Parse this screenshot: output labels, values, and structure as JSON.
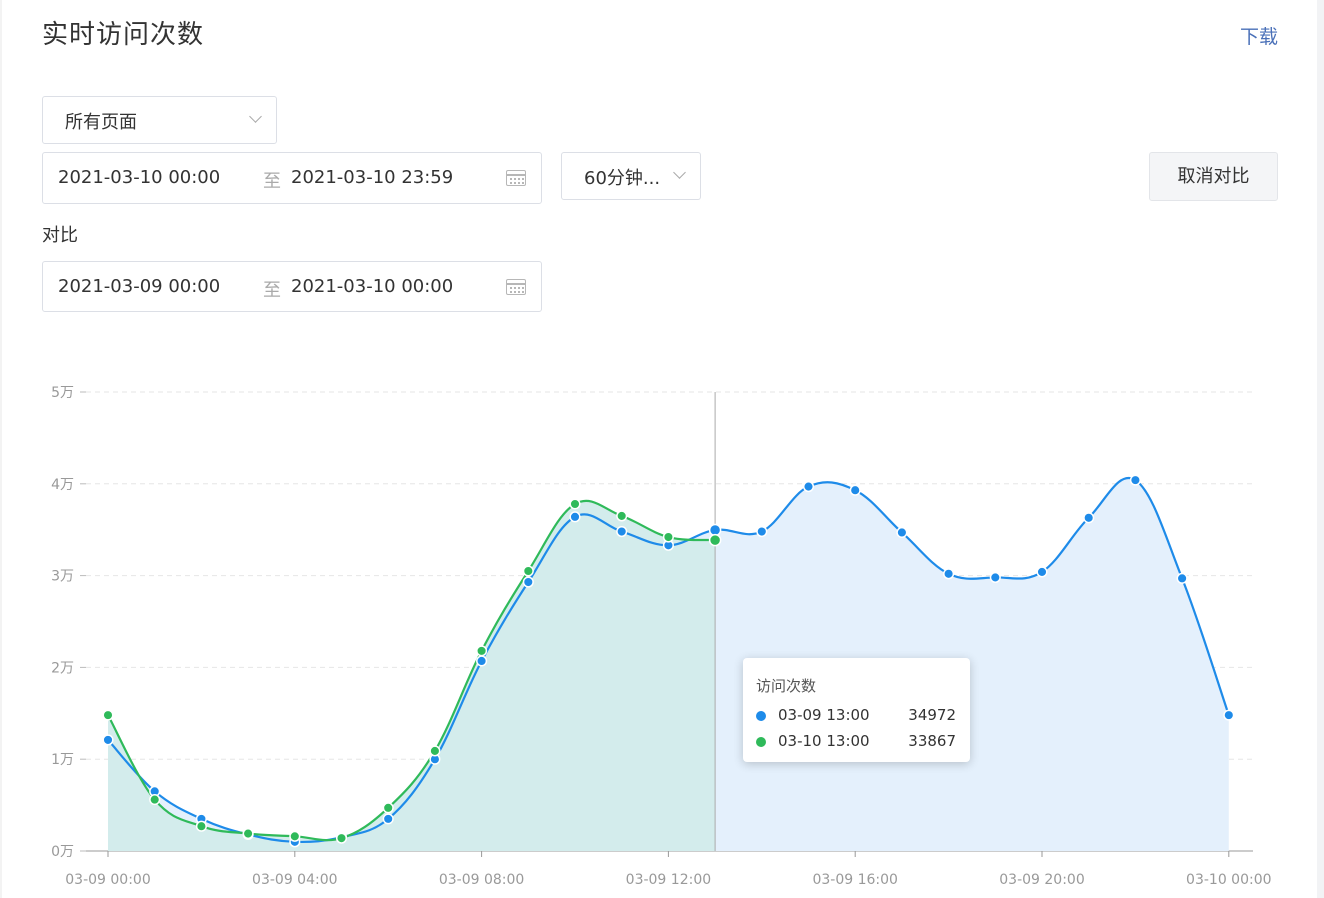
{
  "header": {
    "title": "实时访问次数",
    "download_label": "下载"
  },
  "filters": {
    "page_select": "所有页面",
    "date_range": {
      "start": "2021-03-10 00:00",
      "separator": "至",
      "end": "2021-03-10 23:59"
    },
    "interval_select": "60分钟...",
    "cancel_compare_label": "取消对比",
    "compare_label": "对比",
    "compare_range": {
      "start": "2021-03-09 00:00",
      "separator": "至",
      "end": "2021-03-10 00:00"
    }
  },
  "colors": {
    "series_current": "#1e8be9",
    "series_compare": "#2fba5a",
    "fill_current": "#e4f0fc",
    "fill_compare": "#d3ecec"
  },
  "chart_data": {
    "type": "area",
    "title": "",
    "xlabel": "",
    "ylabel": "",
    "ylim": [
      0,
      50000
    ],
    "y_ticks": [
      "0万",
      "1万",
      "2万",
      "3万",
      "4万",
      "5万"
    ],
    "x_ticks": [
      "03-09 00:00",
      "03-09 04:00",
      "03-09 08:00",
      "03-09 12:00",
      "03-09 16:00",
      "03-09 20:00",
      "03-10 00:00"
    ],
    "grid": true,
    "hover_index": 13,
    "series": [
      {
        "name": "03-09",
        "values": [
          12100,
          6500,
          3500,
          1800,
          1000,
          1500,
          3500,
          10000,
          20700,
          29300,
          36400,
          34800,
          33300,
          34972,
          34800,
          39700,
          39300,
          34700,
          30200,
          29800,
          30400,
          36300,
          40400,
          29700,
          14800
        ]
      },
      {
        "name": "03-10",
        "values": [
          14800,
          5600,
          2700,
          1900,
          1600,
          1400,
          4700,
          10900,
          21800,
          30500,
          37800,
          36500,
          34200,
          33867
        ]
      }
    ]
  },
  "tooltip": {
    "title": "访问次数",
    "rows": [
      {
        "label": "03-09 13:00",
        "value": "34972"
      },
      {
        "label": "03-10 13:00",
        "value": "33867"
      }
    ]
  }
}
